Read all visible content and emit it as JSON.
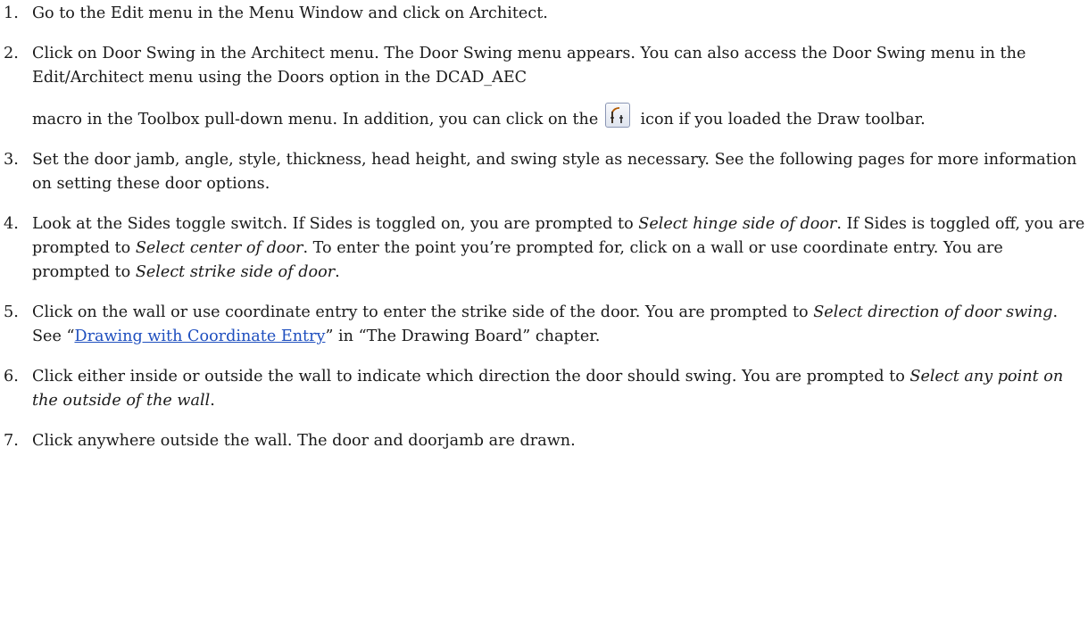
{
  "steps": [
    {
      "num": "1.",
      "text": "Go to the Edit menu in the Menu Window and click on Architect."
    },
    {
      "num": "2.",
      "text_a": "Click on Door Swing in the Architect menu. The Door Swing menu appears. You can also access the Door Swing menu in the Edit/Architect menu using the Doors option in the DCAD_AEC",
      "text_b": "macro in the Toolbox pull-down menu. In addition, you can click on the",
      "text_c": "icon if you loaded the Draw toolbar.",
      "icon": "door-swing-tool-icon"
    },
    {
      "num": "3.",
      "text": "Set the door jamb, angle, style, thickness, head height, and swing style as necessary. See the following pages for more information on setting these door options."
    },
    {
      "num": "4.",
      "t1": "Look at the Sides toggle switch. If Sides is toggled on, you are prompted to ",
      "i1": "Select hinge side of door",
      "t2": ". If Sides is toggled off, you are prompted to ",
      "i2": "Select center of door",
      "t3": ". To enter the point you’re prompted for, click on a wall or use coordinate entry. You are prompted to ",
      "i3": "Select strike side of door",
      "t4": "."
    },
    {
      "num": "5.",
      "t1": "Click on the wall or use coordinate entry to enter the strike side of the door. You are prompted to ",
      "i1": "Select direction of door swing",
      "t2": ". See “",
      "link": "Drawing with Coordinate Entry",
      "t3": "” in “The Drawing Board” chapter."
    },
    {
      "num": "6.",
      "t1": "Click either inside or outside the wall to indicate which direction the door should swing. You are prompted to ",
      "i1": "Select any point on the outside of the wall",
      "t2": "."
    },
    {
      "num": "7.",
      "text": "Click anywhere outside the wall. The door and doorjamb are drawn."
    }
  ],
  "colors": {
    "text": "#1a1a1a",
    "link": "#1f4fbf",
    "icon_border": "#8a96b4",
    "icon_glyph": "#b25a00"
  }
}
